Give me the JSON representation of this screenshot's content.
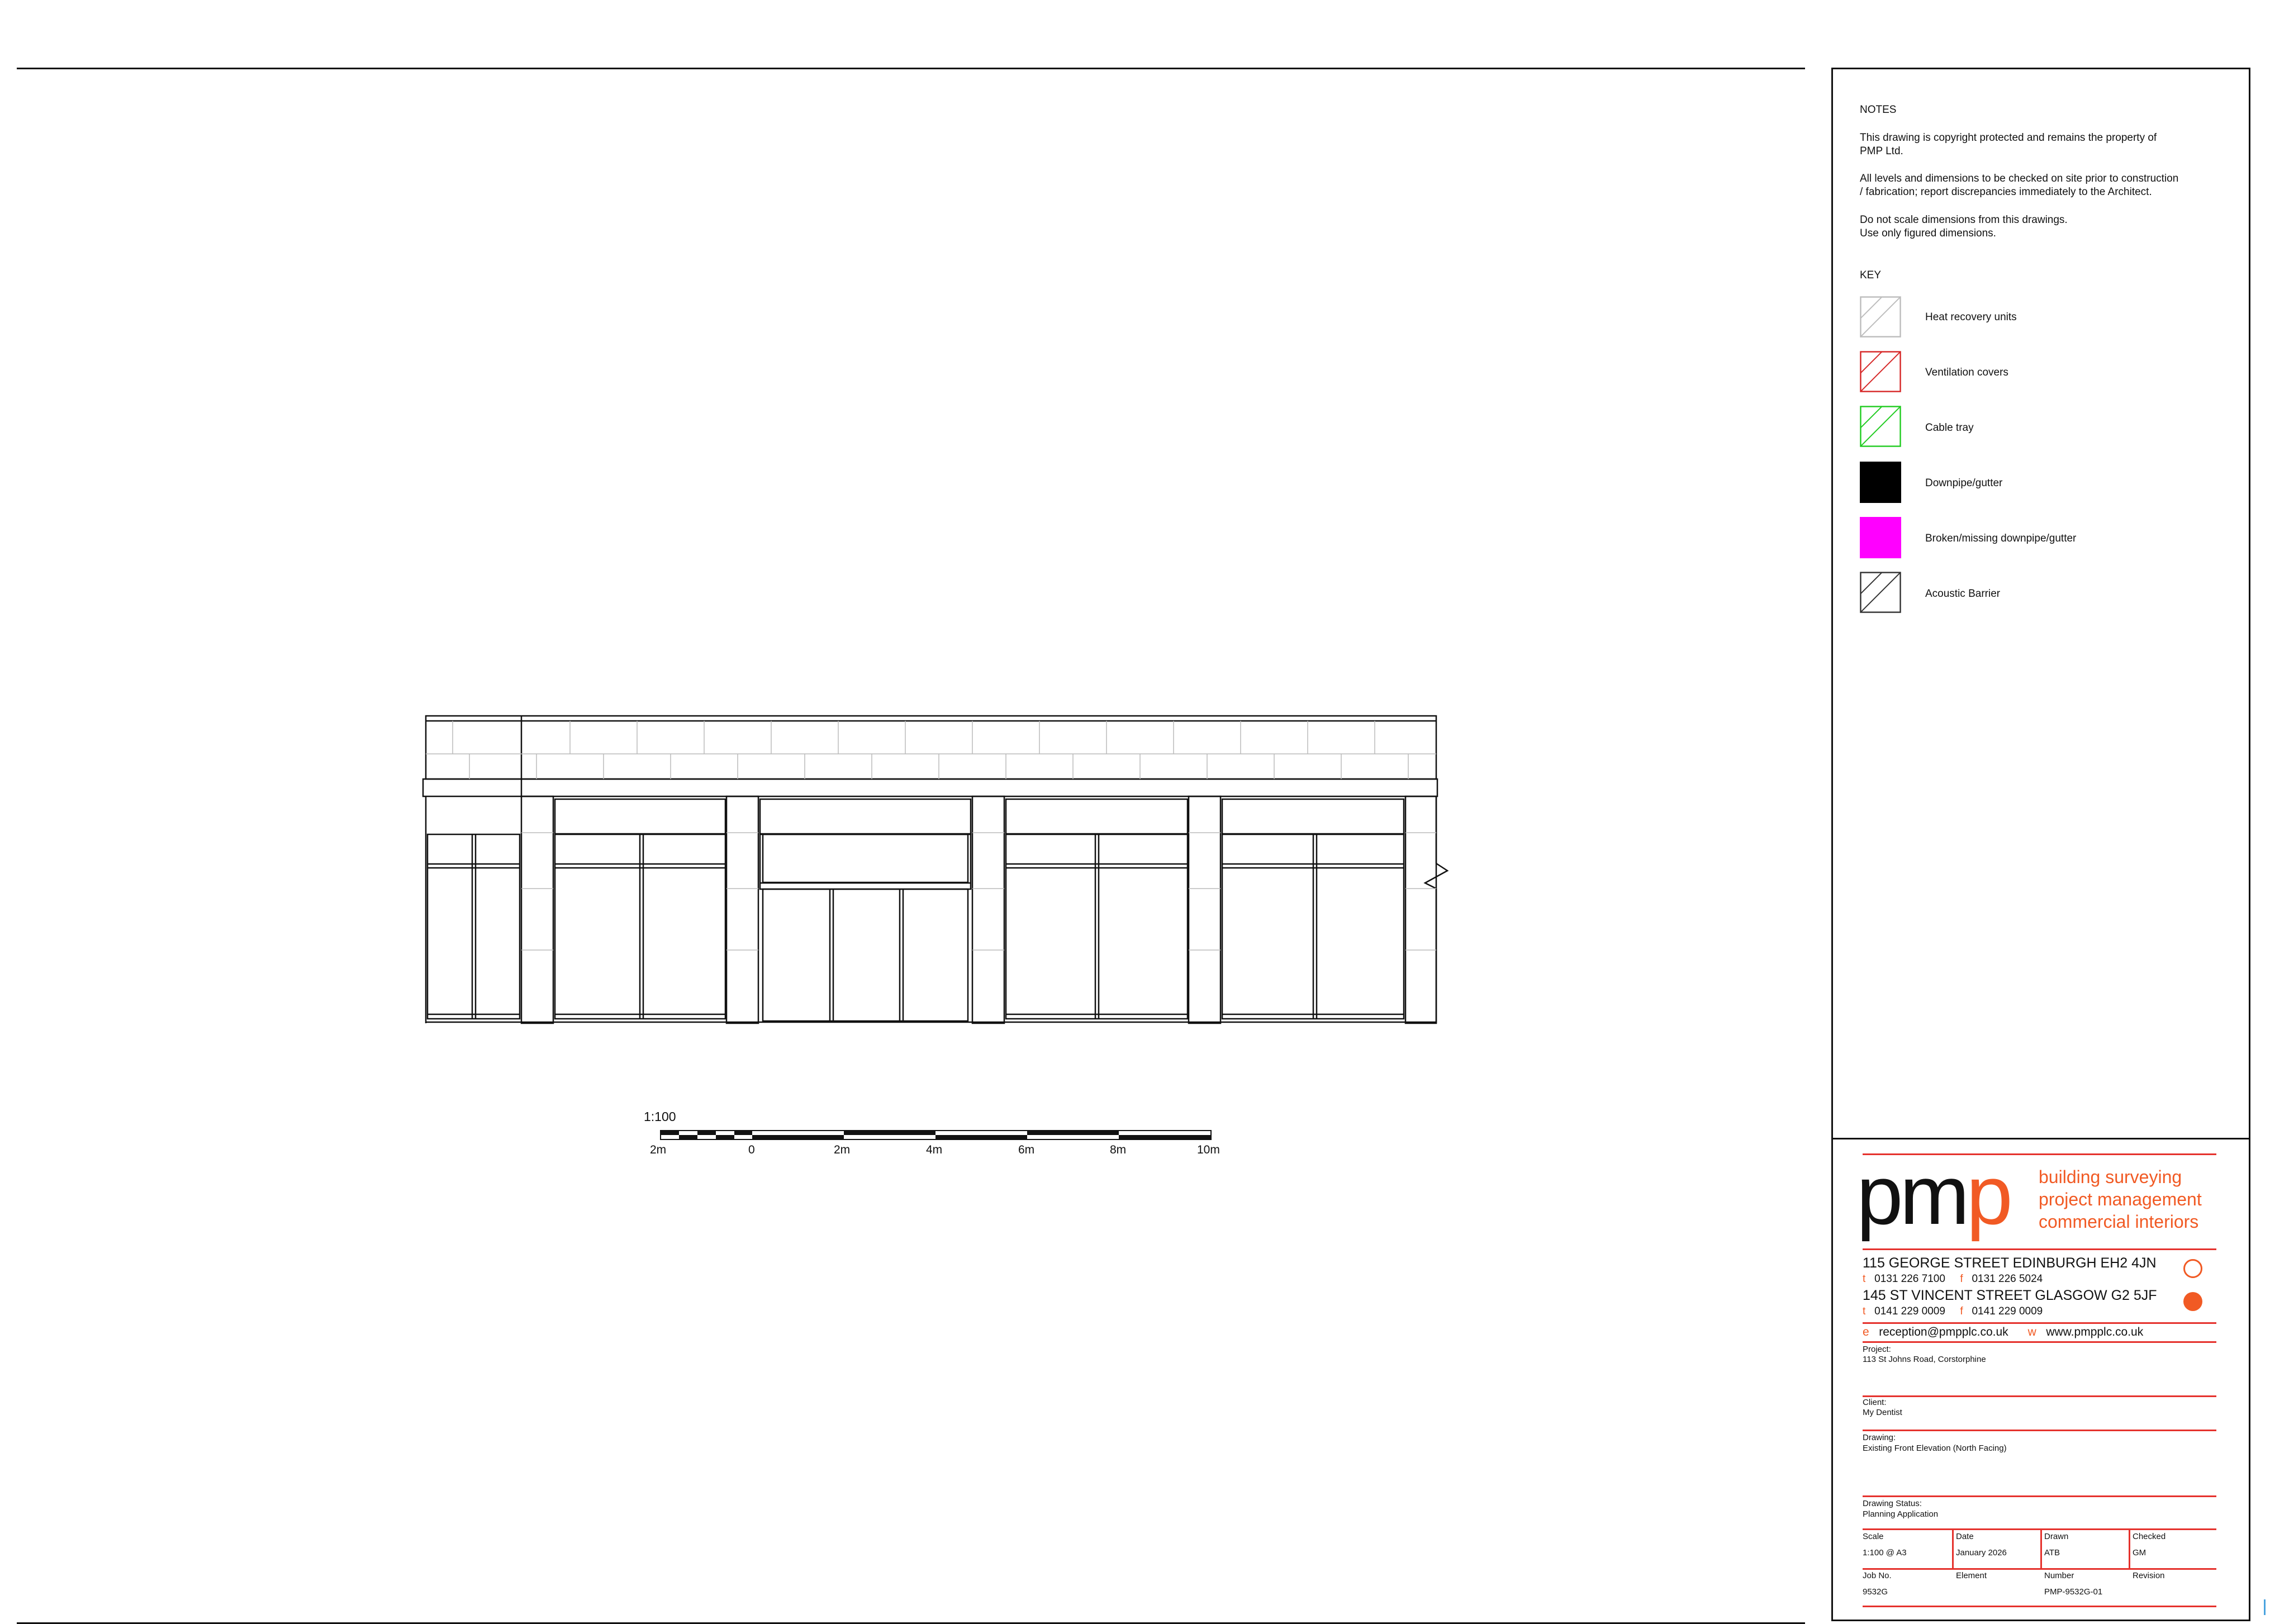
{
  "notes": {
    "heading": "NOTES",
    "copyright_1": "This drawing is copyright protected and remains the property of",
    "copyright_2": "PMP Ltd.",
    "levels_1": "All levels and dimensions to be checked on site prior to construction",
    "levels_2": "/ fabrication; report discrepancies immediately to the Architect.",
    "scale_1": "Do not scale dimensions from this drawings.",
    "scale_2": "Use only figured dimensions."
  },
  "key": {
    "heading": "KEY",
    "items": [
      {
        "label": "Heat recovery units",
        "color": "#bdbdbd",
        "fill": "hatch"
      },
      {
        "label": "Ventilation covers",
        "color": "#d62828",
        "fill": "hatch"
      },
      {
        "label": "Cable tray",
        "color": "#22cc22",
        "fill": "hatch"
      },
      {
        "label": "Downpipe/gutter",
        "color": "#000000",
        "fill": "solid"
      },
      {
        "label": "Broken/missing downpipe/gutter",
        "color": "#ff00ff",
        "fill": "solid"
      },
      {
        "label": "Acoustic Barrier",
        "color": "#333333",
        "fill": "hatch"
      }
    ]
  },
  "scale_bar": {
    "ratio": "1:100",
    "ticks": [
      "2m",
      "0",
      "2m",
      "4m",
      "6m",
      "8m",
      "10m"
    ]
  },
  "company": {
    "logo_text": "pmp",
    "tagline_1": "building surveying",
    "tagline_2": "project management",
    "tagline_3": "commercial interiors",
    "edinburgh_address": "115 GEORGE STREET  EDINBURGH  EH2 4JN",
    "edinburgh_t_label": "t",
    "edinburgh_t": "0131 226 7100",
    "edinburgh_f_label": "f",
    "edinburgh_f": "0131 226 5024",
    "glasgow_address": "145  ST VINCENT STREET  GLASGOW  G2 5JF",
    "glasgow_t_label": "t",
    "glasgow_t": "0141 229 0009",
    "glasgow_f_label": "f",
    "glasgow_f": "0141 229 0009",
    "email_label": "e",
    "email": "reception@pmpplc.co.uk",
    "web_label": "w",
    "web": "www.pmpplc.co.uk",
    "accent": "#f15a24",
    "rule_color": "#e5322d"
  },
  "title_block": {
    "project_label": "Project:",
    "project": "113 St Johns Road, Corstorphine",
    "client_label": "Client:",
    "client": "My Dentist",
    "drawing_label": "Drawing:",
    "drawing": "Existing Front Elevation (North Facing)",
    "status_label": "Drawing Status:",
    "status": "Planning Application",
    "scale_label": "Scale",
    "scale": "1:100 @ A3",
    "date_label": "Date",
    "date": "January 2026",
    "drawn_label": "Drawn",
    "drawn": "ATB",
    "checked_label": "Checked",
    "checked": "GM",
    "job_label": "Job No.",
    "job": "9532G",
    "element_label": "Element",
    "element": "",
    "number_label": "Number",
    "number": "PMP-9532G-01",
    "revision_label": "Revision",
    "revision": ""
  }
}
